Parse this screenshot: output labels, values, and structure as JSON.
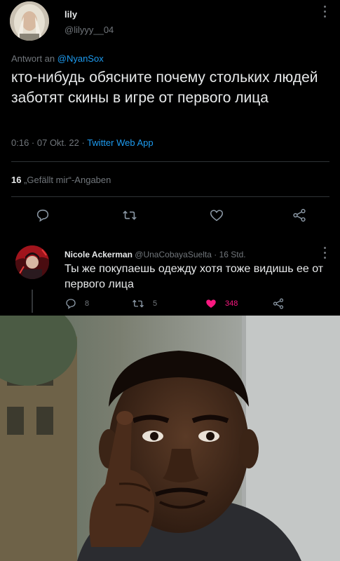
{
  "tweet": {
    "author_name": "lily",
    "author_handle": "@lilyyy__04",
    "reply_prefix": "Antwort an ",
    "reply_mention": "@NyanSox",
    "text": "кто-нибудь обясните почему стольких людей заботят скины в игре от первого лица",
    "time": "0:16",
    "date": "07 Okt. 22",
    "app": "Twitter Web App",
    "likes_count": "16",
    "likes_label": "„Gefällt mir“-Angaben",
    "actions": [
      "reply-icon",
      "retweet-icon",
      "like-icon",
      "share-icon"
    ]
  },
  "reply": {
    "author_name": "Nicole Ackerman",
    "author_handle": "@UnaCobayaSuelta",
    "time": "16 Std.",
    "text": "Ты же покупаешь одежду хотя тоже видишь ее от первого лица",
    "reply_count": "8",
    "retweet_count": "5",
    "like_count": "348"
  },
  "colors": {
    "background": "#000000",
    "text": "#e7e9ea",
    "muted": "#71767b",
    "link": "#1d9bf0",
    "like": "#f91880"
  },
  "meme_image": "roll-safe-thinking-man-photo"
}
